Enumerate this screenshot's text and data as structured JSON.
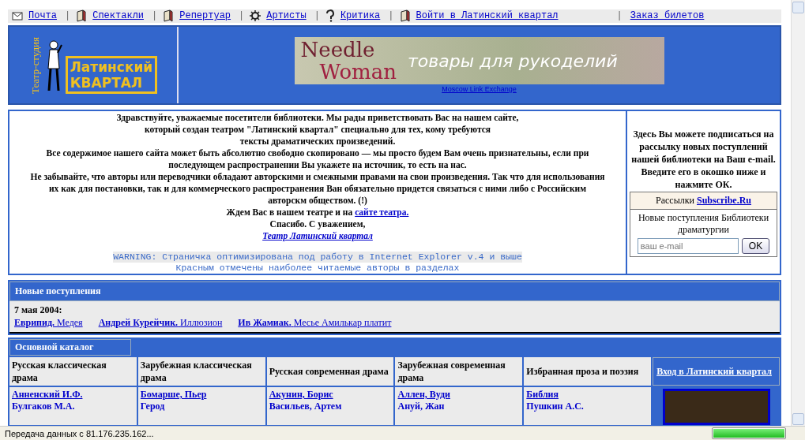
{
  "nav": [
    {
      "label": "Почта"
    },
    {
      "separator": "|",
      "label": "Спектакли"
    },
    {
      "separator": "|",
      "label": "Репертуар"
    },
    {
      "separator": "|",
      "label": "Артисты"
    },
    {
      "separator": "|",
      "label": "Критика"
    },
    {
      "separator": "|",
      "label": "Войти в Латинский квартал"
    },
    {
      "separator": "|",
      "label": "Заказ билетов"
    }
  ],
  "logo": {
    "top": "Латинский",
    "bottom": "КВАРТАЛ",
    "side": "Театр-студия"
  },
  "banner": {
    "brand_1": "Needle",
    "brand_2": "Woman",
    "slogan": "товары для рукоделий",
    "link": "Moscow Link Exchange"
  },
  "intro": {
    "lines": [
      "Здравствуйте, уважаемые посетители библиотеки. Мы рады приветствовать Вас на нашем сайте,",
      "который создан театром \"Латинский квартал\" специально для тех, кому требуются",
      "тексты драматических произведений.",
      "Все содержимое нашего сайта может быть абсолютно свободно скопировано — мы просто будем Вам очень признательны, если при",
      "последующем распространении Вы укажете на источник, то есть на нас.",
      "Не забывайте, что авторы или переводчики обладают авторскими и смежными правами на свои произведения. Так что для использования",
      "их как для постановки, так и для коммерческого распространения Ван обязательно придется связаться с ними либо с Российским",
      "авторскм обществом. (!)"
    ],
    "invite": "Ждем Вас в нашем театре и на",
    "invite_link": "сайте театра.",
    "thanks": "Спасибо. С уважением,",
    "signature": "Театр Латинский квартал",
    "warnings": [
      "WARNING: Страничка оптимизирована под работу в Internet Explorer v.4 и выше",
      "Красным отмечены наиболее читаемые авторы в разделах"
    ]
  },
  "subscribe": {
    "text": "Здесь Вы можете подписаться на рассылку новых поступлений нашей библиотеки на Ваш e-mail. Введите его в окошко ниже и нажмите ОК.",
    "service_label": "Рассылки",
    "service_link": "Subscribe.Ru",
    "list_name": "Новые поступления Библиотеки драматургии",
    "placeholder": "ваш e-mail",
    "button": "OK"
  },
  "new_arrivals": {
    "title": "Новые поступления",
    "date": "7 мая 2004:",
    "items": [
      {
        "author": "Еврипид.",
        "title": "Медея"
      },
      {
        "author": "Андрей Курейчик.",
        "title": "Иллюзион"
      },
      {
        "author": "Ив Жамиак.",
        "title": "Месье Амилькар платит"
      }
    ]
  },
  "catalog": {
    "title": "Основной каталог",
    "columns": [
      {
        "heading": "Русская классическая драма",
        "entries": [
          "Анненский И.Ф.",
          "Булгаков М.А."
        ]
      },
      {
        "heading": "Зарубежная классическая драма",
        "entries": [
          "Бомарше, Пьер",
          "Герод"
        ]
      },
      {
        "heading": "Русская современная драма",
        "entries": [
          "Акунин, Борис",
          "Васильев, Артем"
        ]
      },
      {
        "heading": "Зарубежная современная драма",
        "entries": [
          "Аллен, Вуди",
          "Ануй, Жан"
        ]
      },
      {
        "heading": "Избранная проза и поэзия",
        "entries": [
          "Библия",
          "Пушкин А.С."
        ]
      }
    ],
    "entry_link": "Вход в Латинский квартал"
  },
  "status_bar": {
    "text": "Передача данных с 81.176.235.162...",
    "progress": {
      "level": 1
    }
  }
}
